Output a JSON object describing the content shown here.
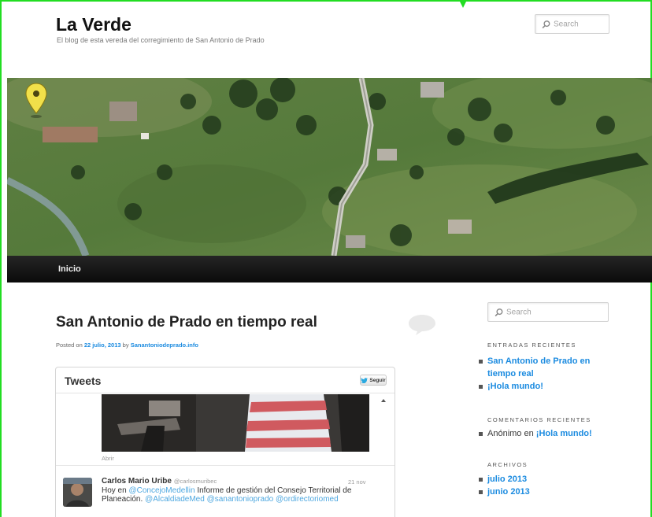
{
  "site": {
    "title": "La Verde",
    "description": "El blog de esta vereda del corregimiento de San Antonio de Prado"
  },
  "search": {
    "placeholder": "Search"
  },
  "nav": {
    "items": [
      "Inicio"
    ]
  },
  "post": {
    "title": "San Antonio de Prado en tiempo real",
    "meta_prefix": "Posted on",
    "date": "22 julio, 2013",
    "meta_by": "by",
    "author": "Sanantoniodeprado.info"
  },
  "tweets_widget": {
    "title": "Tweets",
    "follow_label": "Seguir",
    "open_label": "Abrir",
    "tweet": {
      "author": "Carlos Mario Uribe",
      "handle": "@carlosmuribec",
      "time": "21 nov",
      "text_prefix": "Hoy en",
      "mention1": "@ConcejoMedellin",
      "text_middle": "Informe de gestión del Consejo Territorial de Planeación.",
      "mention2": "@AlcaldiadeMed",
      "mention3": "@sanantonioprado",
      "mention4": "@ordirectoriomed"
    }
  },
  "sidebar": {
    "recent_posts_title": "ENTRADAS RECIENTES",
    "recent_posts": [
      "San Antonio de Prado en tiempo real",
      "¡Hola mundo!"
    ],
    "recent_comments_title": "COMENTARIOS RECIENTES",
    "recent_comment": {
      "author": "Anónimo",
      "on": "en",
      "post": "¡Hola mundo!"
    },
    "archives_title": "ARCHIVOS",
    "archives": [
      "julio 2013",
      "junio 2013"
    ]
  },
  "colors": {
    "link": "#1b8be0",
    "nav_bg": "#111111",
    "frame": "#22dd22"
  }
}
